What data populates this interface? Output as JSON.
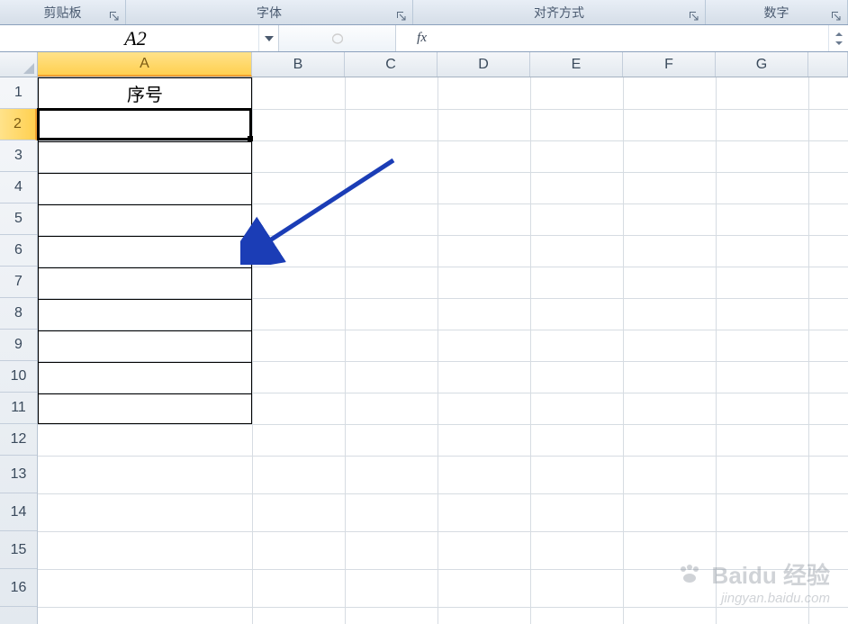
{
  "ribbon": {
    "groups": [
      {
        "label": "剪贴板"
      },
      {
        "label": "字体"
      },
      {
        "label": "对齐方式"
      },
      {
        "label": "数字"
      }
    ]
  },
  "formula_bar": {
    "name_box": "A2",
    "fx_label": "fx",
    "formula_value": ""
  },
  "columns": [
    "A",
    "B",
    "C",
    "D",
    "E",
    "F",
    "G"
  ],
  "rows": [
    "1",
    "2",
    "3",
    "4",
    "5",
    "6",
    "7",
    "8",
    "9",
    "10",
    "11",
    "12",
    "13",
    "14",
    "15",
    "16"
  ],
  "selected_cell": "A2",
  "cells": {
    "A1": "序号"
  },
  "bordered_range": "A1:A11",
  "watermark": {
    "line1": "Baidu 经验",
    "line2": "jingyan.baidu.com"
  }
}
